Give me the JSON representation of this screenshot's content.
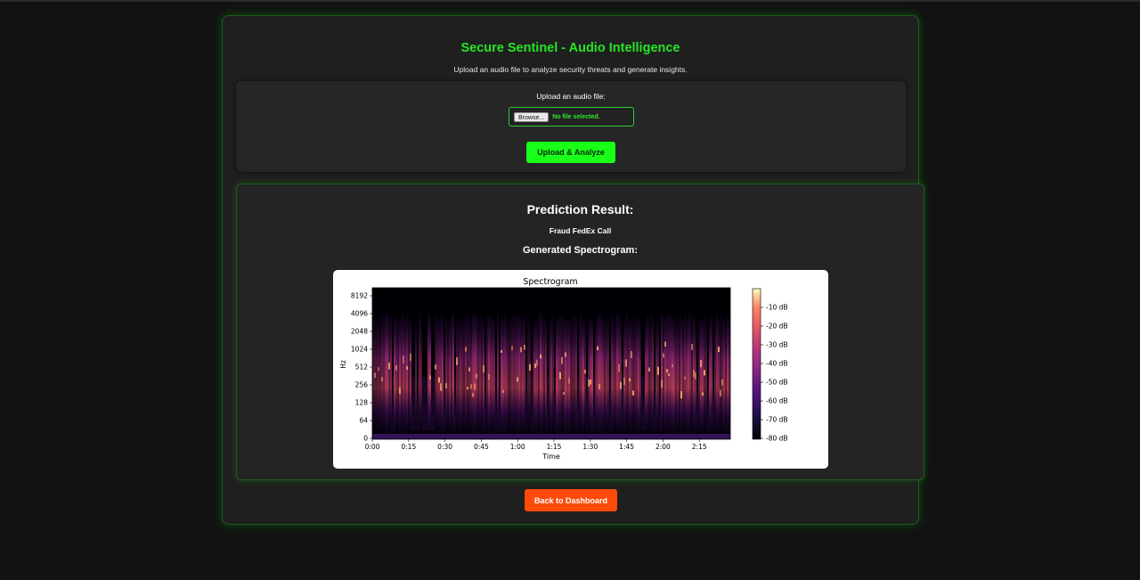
{
  "page": {
    "title": "Secure Sentinel - Audio Intelligence",
    "subtitle": "Upload an audio file to analyze security threats and generate insights."
  },
  "upload": {
    "label": "Upload an audio file:",
    "browse_label": "Browse...",
    "file_status": "No file selected.",
    "submit_label": "Upload & Analyze"
  },
  "result": {
    "heading": "Prediction Result:",
    "prediction": "Fraud FedEx Call",
    "spectrogram_heading": "Generated Spectrogram:"
  },
  "chart_data": {
    "type": "heatmap",
    "title": "Spectrogram",
    "xlabel": "Time",
    "ylabel": "Hz",
    "x_ticks": [
      "0:00",
      "0:15",
      "0:30",
      "0:45",
      "1:00",
      "1:15",
      "1:30",
      "1:45",
      "2:00",
      "2:15"
    ],
    "y_ticks": [
      "8192",
      "4096",
      "2048",
      "1024",
      "512",
      "256",
      "128",
      "64",
      "0"
    ],
    "colorbar_ticks": [
      "-10 dB",
      "-20 dB",
      "-30 dB",
      "-40 dB",
      "-50 dB",
      "-60 dB",
      "-70 dB",
      "-80 dB"
    ],
    "colormap": "magma",
    "colorbar_range_db": [
      -80,
      0
    ]
  },
  "footer": {
    "back_label": "Back to Dashboard"
  },
  "colors": {
    "accent_green": "#25e625",
    "button_green": "#19ff19",
    "button_orange": "#ff4a0a",
    "background": "#121212",
    "card": "#1f1f1f"
  }
}
